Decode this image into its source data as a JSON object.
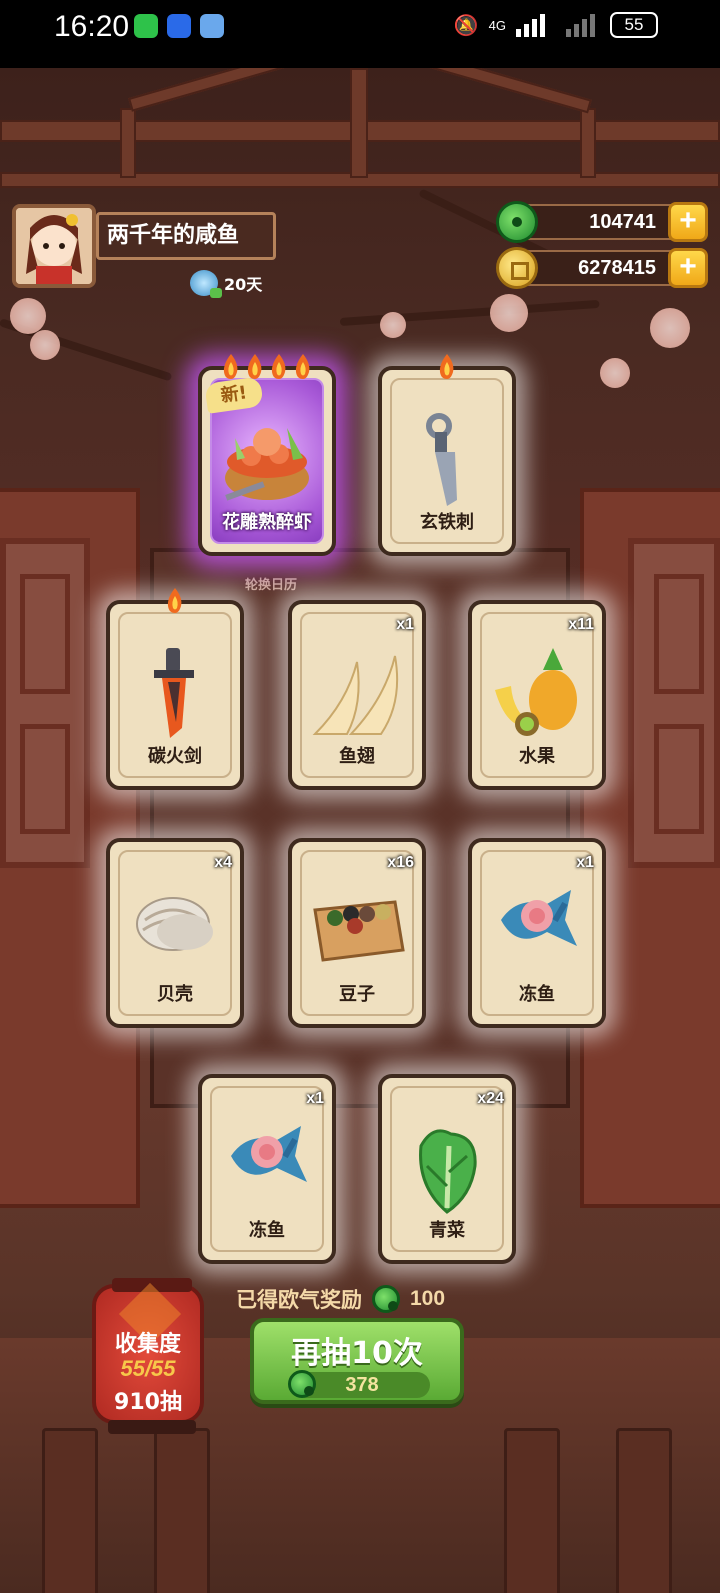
{
  "status_bar": {
    "time": "16:20",
    "network": "4G",
    "battery": "55"
  },
  "player": {
    "name": "两千年的咸鱼",
    "days": "20天"
  },
  "currency": {
    "jade": "104741",
    "coins": "6278415"
  },
  "rotation_label": "轮换日历",
  "cards": [
    {
      "name": "花雕熟醉虾",
      "count": "",
      "flames": 4,
      "is_new": true,
      "new_label": "新!",
      "rarity": "purple",
      "icon": "drunken-shrimp-pot-icon"
    },
    {
      "name": "玄铁刺",
      "count": "",
      "flames": 1,
      "is_new": false,
      "rarity": "normal",
      "icon": "iron-dagger-icon"
    },
    {
      "name": "碳火剑",
      "count": "",
      "flames": 1,
      "is_new": false,
      "rarity": "normal",
      "icon": "charcoal-sword-icon"
    },
    {
      "name": "鱼翅",
      "count": "x1",
      "flames": 0,
      "is_new": false,
      "rarity": "normal",
      "icon": "shark-fin-icon"
    },
    {
      "name": "水果",
      "count": "x11",
      "flames": 0,
      "is_new": false,
      "rarity": "normal",
      "icon": "fruit-icon"
    },
    {
      "name": "贝壳",
      "count": "x4",
      "flames": 0,
      "is_new": false,
      "rarity": "normal",
      "icon": "clam-shell-icon"
    },
    {
      "name": "豆子",
      "count": "x16",
      "flames": 0,
      "is_new": false,
      "rarity": "normal",
      "icon": "beans-box-icon"
    },
    {
      "name": "冻鱼",
      "count": "x1",
      "flames": 0,
      "is_new": false,
      "rarity": "normal",
      "icon": "frozen-fish-icon"
    },
    {
      "name": "冻鱼",
      "count": "x1",
      "flames": 0,
      "is_new": false,
      "rarity": "normal",
      "icon": "frozen-fish-icon"
    },
    {
      "name": "青菜",
      "count": "x24",
      "flames": 0,
      "is_new": false,
      "rarity": "normal",
      "icon": "greens-icon"
    }
  ],
  "reward": {
    "label": "已得欧气奖励",
    "value": "100"
  },
  "draw_button": {
    "label": "再抽10次",
    "cost": "378"
  },
  "collection": {
    "title": "收集度",
    "progress": "55/55",
    "draws": "910抽"
  },
  "colors": {
    "card_bg": "#efe0c0",
    "purple_glow": "#c85aff",
    "button_green": "#5aaa34",
    "lantern_red": "#b02a22"
  }
}
